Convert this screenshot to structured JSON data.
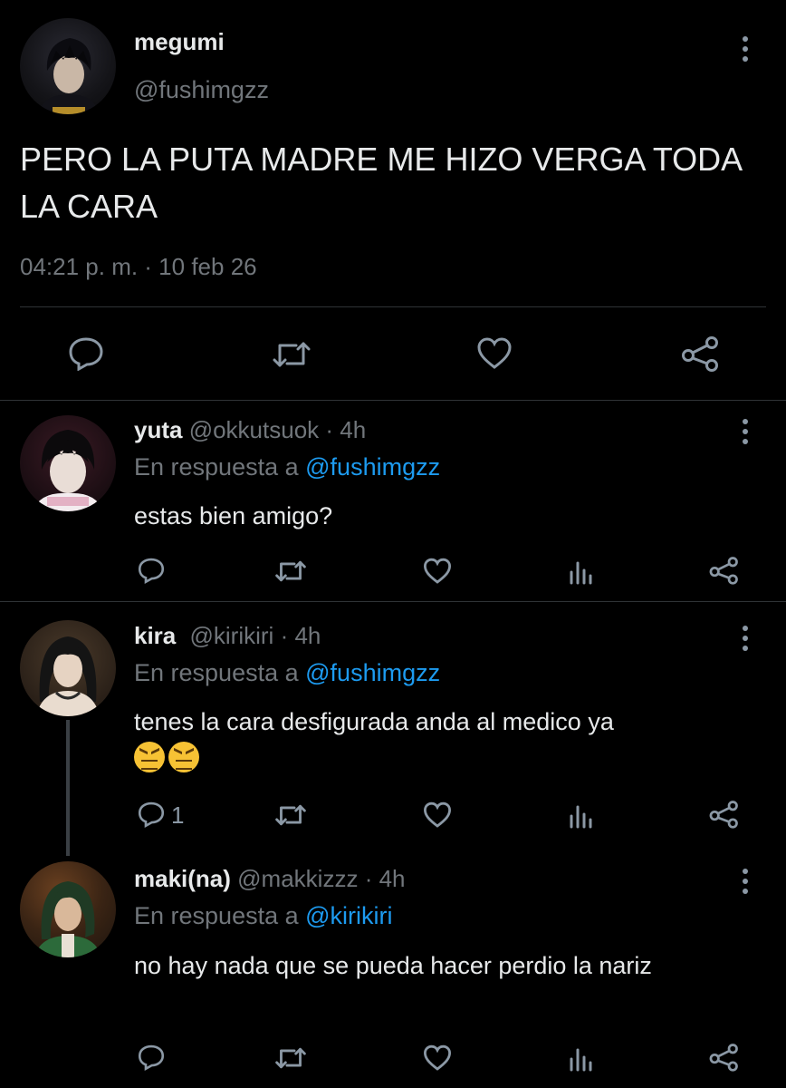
{
  "main_tweet": {
    "name": "megumi",
    "handle": "@fushimgzz",
    "text": "PERO LA PUTA MADRE ME HIZO VERGA TODA LA CARA",
    "timestamp": "04:21 p. m. · 10 feb 26"
  },
  "replies": [
    {
      "name": "yuta",
      "handle": "@okkutsuok",
      "time": "· 4h",
      "reply_prefix": "En respuesta a",
      "reply_to": "@fushimgzz",
      "text": "estas bien amigo?"
    },
    {
      "name": "kira",
      "handle": "@kirikiri",
      "time": "· 4h",
      "reply_prefix": "En respuesta a",
      "reply_to": "@fushimgzz",
      "text": "tenes la cara desfigurada anda al medico ya",
      "emojis": [
        "😖",
        "😖"
      ],
      "reply_count": "1"
    },
    {
      "name": "maki(na)",
      "handle": "@makkizzz",
      "time": "· 4h",
      "reply_prefix": "En respuesta a",
      "reply_to": "@kirikiri",
      "text": "no hay nada que se pueda hacer perdio la nariz"
    }
  ],
  "colors": {
    "background": "#000000",
    "text": "#e7e9ea",
    "muted": "#71767b",
    "link": "#1d9bf0",
    "divider": "#2f3336"
  }
}
